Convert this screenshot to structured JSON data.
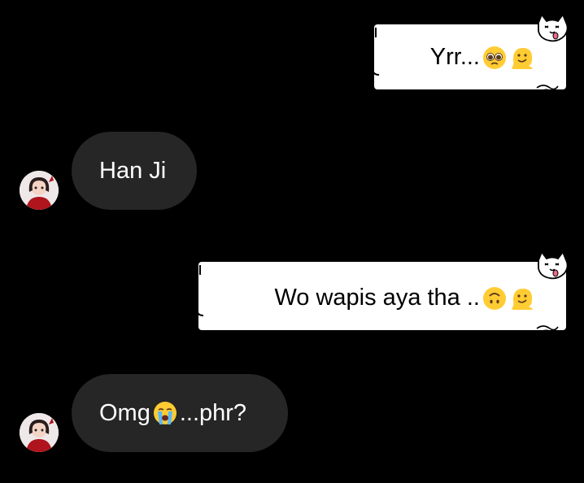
{
  "messages": [
    {
      "direction": "sent",
      "text": "Yrr...",
      "emojis": [
        "pleading-face-emoji",
        "melting-face-emoji"
      ]
    },
    {
      "direction": "received",
      "text": "Han Ji",
      "emojis": []
    },
    {
      "direction": "sent",
      "text": "Wo wapis aya tha ..",
      "emojis": [
        "upside-down-face-emoji",
        "melting-face-emoji"
      ]
    },
    {
      "direction": "received",
      "text_before": "Omg",
      "text_after": "...phr?",
      "emojis": [
        "loudly-crying-face-emoji"
      ]
    }
  ],
  "colors": {
    "background": "#000000",
    "sent_bubble": "#ffffff",
    "received_bubble": "#262626",
    "emoji_yellow": "#ffcc33"
  }
}
